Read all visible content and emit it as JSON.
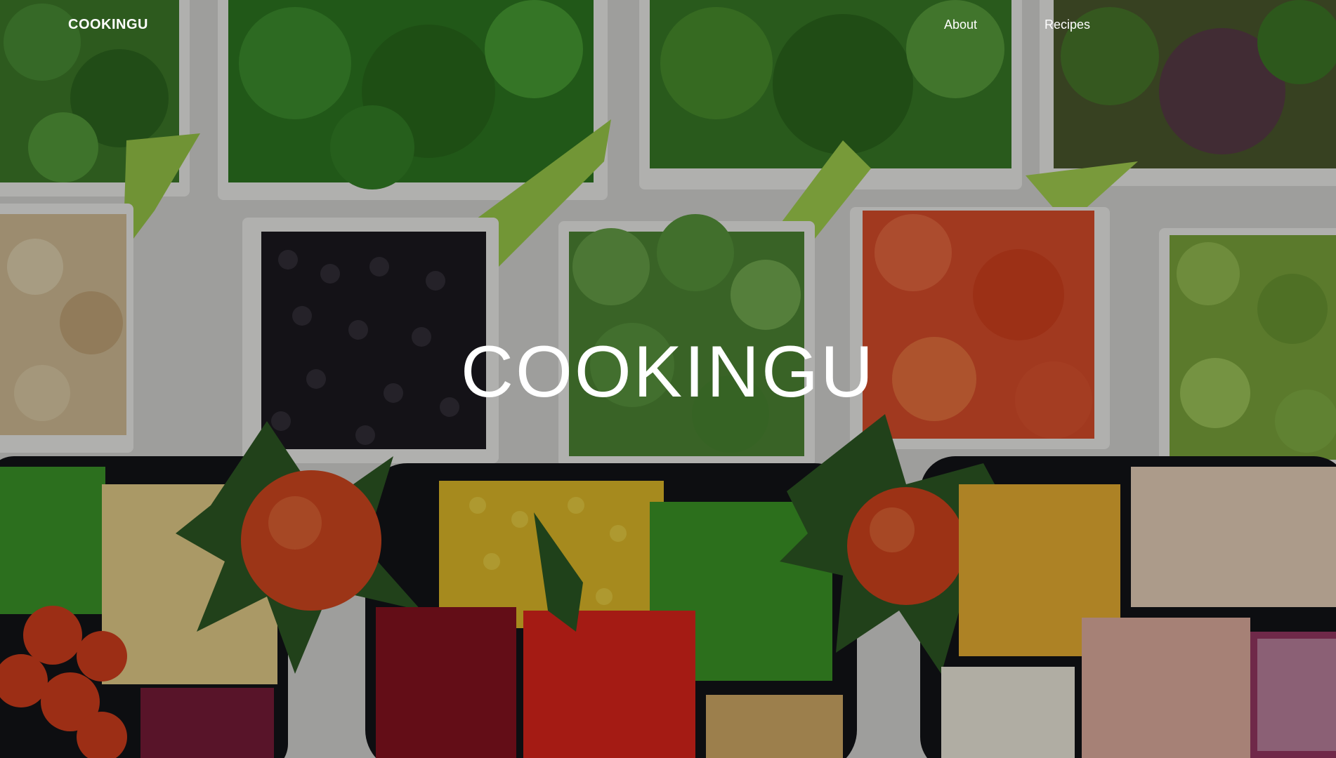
{
  "navbar": {
    "brand": "COOKINGU",
    "links": [
      {
        "label": "About"
      },
      {
        "label": "Recipes"
      }
    ]
  },
  "hero": {
    "title": "COOKINGU",
    "background_image": "overhead photo of bowls of salad ingredients (greens, olives, broccoli, tomatoes, brussels sprouts, corn, peppers, beans, cheese, ham) with dark overlay"
  },
  "colors": {
    "text": "#ffffff",
    "overlay": "rgba(0,0,0,0.28)"
  }
}
